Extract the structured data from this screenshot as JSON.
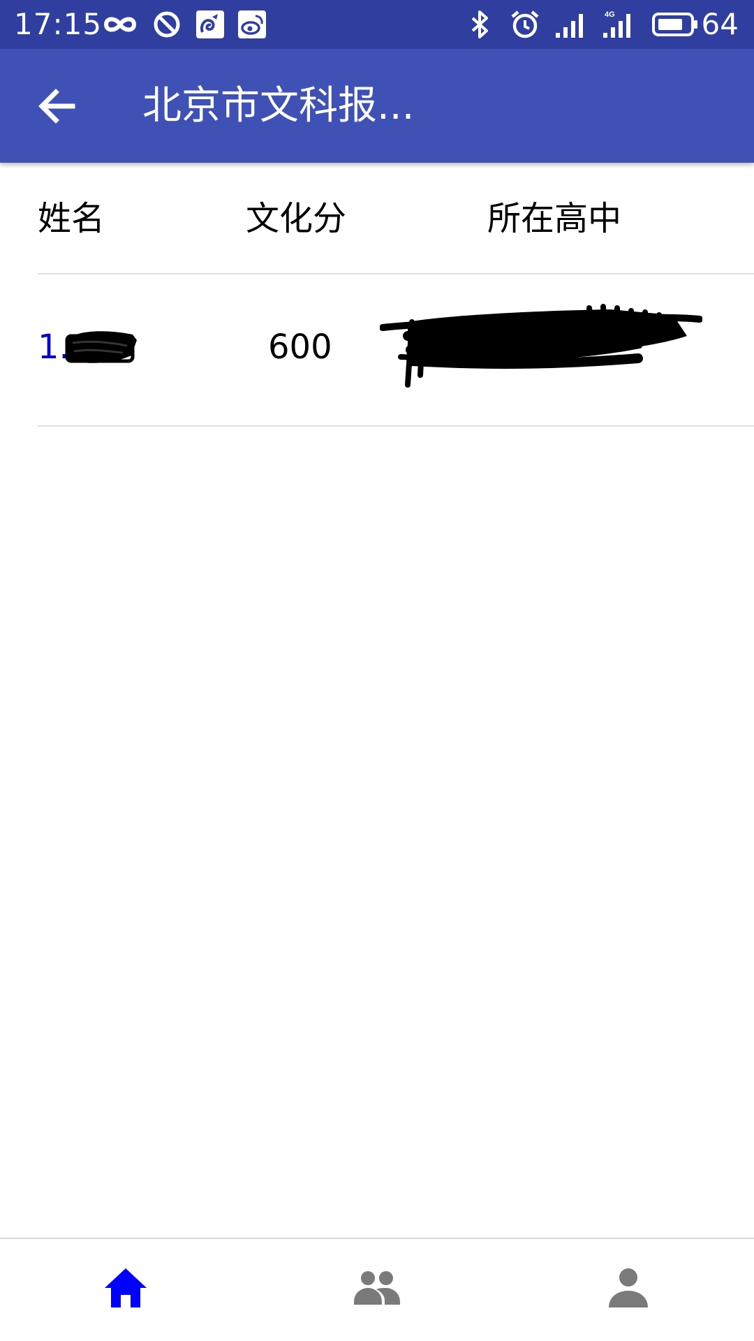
{
  "status_bar": {
    "time": "17:15",
    "battery_percent": "64",
    "network_label": "4G",
    "icons": [
      "infinity-icon",
      "block-icon",
      "uc-browser-icon",
      "weibo-icon",
      "bluetooth-icon",
      "alarm-icon",
      "signal-icon",
      "signal-4g-icon",
      "battery-icon"
    ]
  },
  "app_bar": {
    "back_icon": "arrow-back-icon",
    "title": "北京市文科报..."
  },
  "table": {
    "columns": [
      "姓名",
      "文化分",
      "所在高中"
    ],
    "rows": [
      {
        "index": "1.",
        "name_redacted": true,
        "score": "600",
        "school_redacted": true
      }
    ]
  },
  "bottom_nav": {
    "items": [
      {
        "icon": "home-icon",
        "active": true
      },
      {
        "icon": "group-icon",
        "active": false
      },
      {
        "icon": "person-icon",
        "active": false
      }
    ],
    "active_color": "#0000ff",
    "inactive_color": "#7a7a7a"
  },
  "colors": {
    "status_bar": "#303f9f",
    "app_bar": "#3f51b5",
    "row_index": "#0000cc"
  }
}
